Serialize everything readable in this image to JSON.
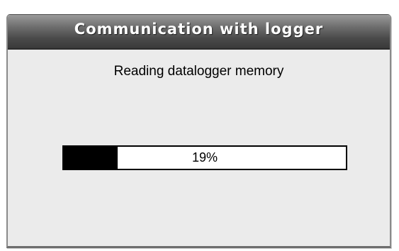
{
  "dialog": {
    "title": "Communication with logger",
    "message": "Reading datalogger memory"
  },
  "progress": {
    "value": 0.19,
    "label": "19%"
  },
  "colors": {
    "fill": "#000000",
    "track": "#ffffff",
    "body_bg": "#ebebeb",
    "titlebar": "#4a4a4a"
  }
}
